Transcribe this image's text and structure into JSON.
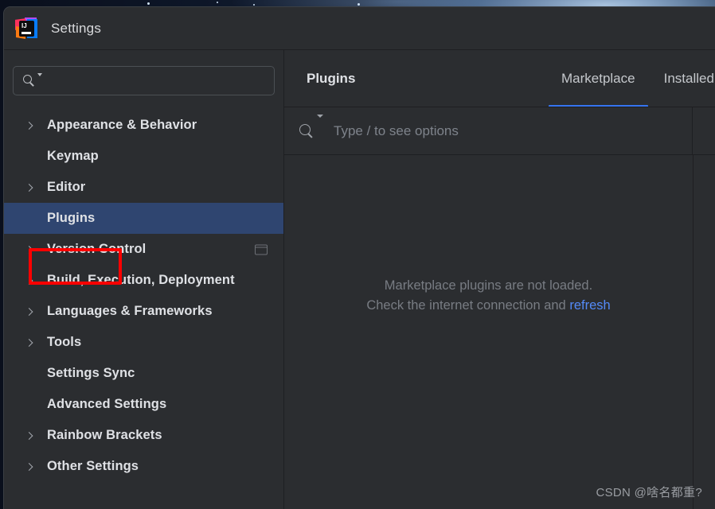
{
  "window": {
    "title": "Settings",
    "app_icon": "intellij-idea-logo"
  },
  "sidebar": {
    "search": {
      "placeholder": "",
      "value": "",
      "icon": "search-icon"
    },
    "items": [
      {
        "label": "Appearance & Behavior",
        "expandable": true,
        "selected": false,
        "badge": false
      },
      {
        "label": "Keymap",
        "expandable": false,
        "selected": false,
        "badge": false
      },
      {
        "label": "Editor",
        "expandable": true,
        "selected": false,
        "badge": false
      },
      {
        "label": "Plugins",
        "expandable": false,
        "selected": true,
        "badge": false
      },
      {
        "label": "Version Control",
        "expandable": true,
        "selected": false,
        "badge": true
      },
      {
        "label": "Build, Execution, Deployment",
        "expandable": true,
        "selected": false,
        "badge": false
      },
      {
        "label": "Languages & Frameworks",
        "expandable": true,
        "selected": false,
        "badge": false
      },
      {
        "label": "Tools",
        "expandable": true,
        "selected": false,
        "badge": false
      },
      {
        "label": "Settings Sync",
        "expandable": false,
        "selected": false,
        "badge": false
      },
      {
        "label": "Advanced Settings",
        "expandable": false,
        "selected": false,
        "badge": false
      },
      {
        "label": "Rainbow Brackets",
        "expandable": true,
        "selected": false,
        "badge": false
      },
      {
        "label": "Other Settings",
        "expandable": true,
        "selected": false,
        "badge": false
      }
    ]
  },
  "content": {
    "panel_title": "Plugins",
    "tabs": [
      {
        "label": "Marketplace",
        "active": true
      },
      {
        "label": "Installed",
        "active": false
      }
    ],
    "search": {
      "placeholder": "Type / to see options",
      "value": "",
      "icon": "search-icon"
    },
    "empty_state": {
      "line1": "Marketplace plugins are not loaded.",
      "line2_prefix": "Check the internet connection and ",
      "link": "refresh"
    }
  },
  "annotation": {
    "target": "Plugins",
    "color": "#fe0000"
  },
  "watermark": {
    "text": "CSDN @啥名都重?"
  },
  "colors": {
    "window_bg": "#2b2d30",
    "selection_blue": "#2f4570",
    "accent_blue": "#3574f0",
    "link_blue": "#548af7",
    "text_primary": "#dfe1e5",
    "text_muted": "#787c83",
    "divider": "#1e1f22",
    "annotation_red": "#fe0000"
  }
}
